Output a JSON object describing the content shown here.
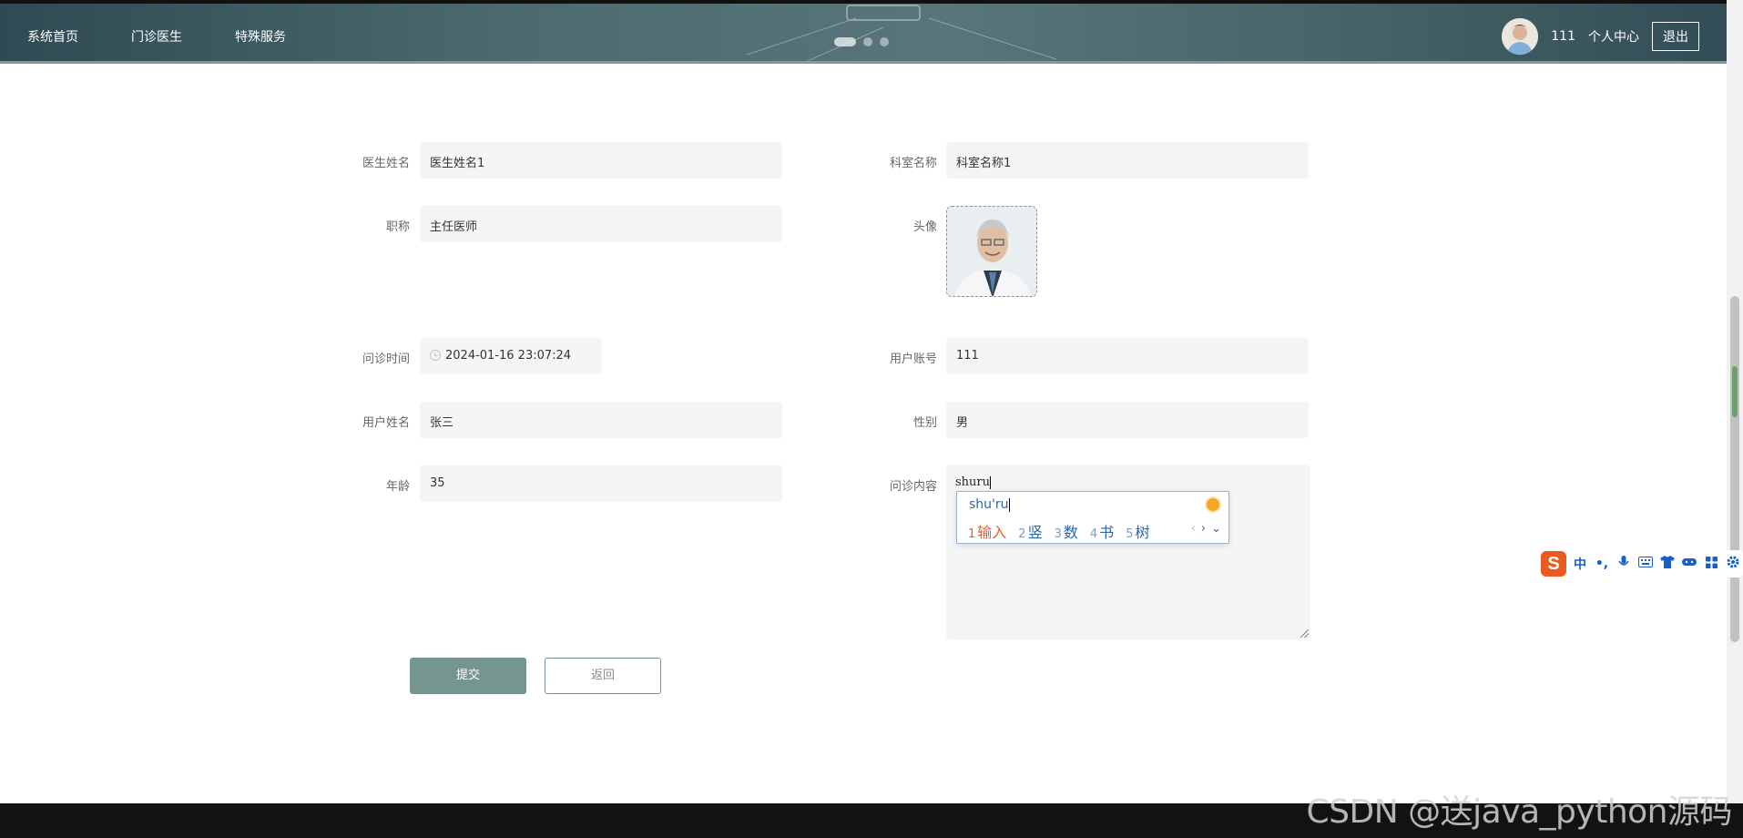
{
  "header": {
    "nav": [
      "系统首页",
      "门诊医生",
      "特殊服务"
    ],
    "user_name": "111",
    "user_center": "个人中心",
    "logout": "退出"
  },
  "form": {
    "doctor_name": {
      "label": "医生姓名",
      "value": "医生姓名1"
    },
    "department": {
      "label": "科室名称",
      "value": "科室名称1"
    },
    "title": {
      "label": "职称",
      "value": "主任医师"
    },
    "avatar": {
      "label": "头像"
    },
    "consult_time": {
      "label": "问诊时间",
      "value": "2024-01-16 23:07:24"
    },
    "account": {
      "label": "用户账号",
      "value": "111"
    },
    "user_name": {
      "label": "用户姓名",
      "value": "张三"
    },
    "gender": {
      "label": "性别",
      "value": "男"
    },
    "age": {
      "label": "年龄",
      "value": "35"
    },
    "content": {
      "label": "问诊内容",
      "value": "shuru"
    }
  },
  "ime": {
    "composition": "shu'ru",
    "candidates": [
      {
        "num": "1",
        "text": "输入"
      },
      {
        "num": "2",
        "text": "竖"
      },
      {
        "num": "3",
        "text": "数"
      },
      {
        "num": "4",
        "text": "书"
      },
      {
        "num": "5",
        "text": "树"
      }
    ]
  },
  "buttons": {
    "submit": "提交",
    "back": "返回"
  },
  "sogou_toolbar": {
    "logo": "S",
    "mode": "中",
    "punct": "•,"
  },
  "watermark": "CSDN @送java_python源码",
  "colors": {
    "accent": "#75968f",
    "header": "#4d6a70",
    "ime_highlight": "#e0632e"
  }
}
